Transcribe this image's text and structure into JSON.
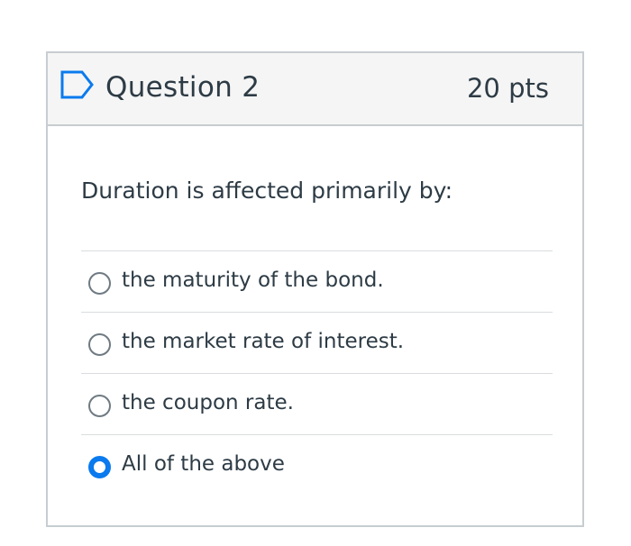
{
  "question": {
    "title": "Question 2",
    "points": "20 pts",
    "flag_icon": "flag-outline-icon",
    "text": "Duration is affected primarily by:"
  },
  "answers": [
    {
      "label": "the maturity of the bond.",
      "selected": false
    },
    {
      "label": "the market rate of interest.",
      "selected": false
    },
    {
      "label": "the coupon rate.",
      "selected": false
    },
    {
      "label": "All of the above",
      "selected": true
    }
  ],
  "colors": {
    "accent": "#0a7aee",
    "border": "#c7cdd1",
    "header_bg": "#f5f5f5",
    "text": "#2d3b45"
  }
}
